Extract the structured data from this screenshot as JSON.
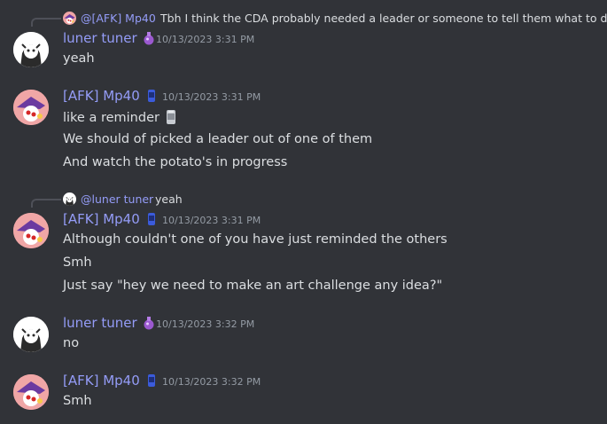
{
  "messages": [
    {
      "reply": {
        "author": "@[AFK] Mp40",
        "text": "Tbh I think the CDA probably needed a leader or someone to tell them what to do"
      },
      "author": "luner tuner",
      "timestamp": "10/13/2023 3:31 PM",
      "lines": [
        "yeah"
      ]
    },
    {
      "author": "[AFK] Mp40",
      "timestamp": "10/13/2023 3:31 PM",
      "lines": [
        "like a reminder",
        "We should of picked a leader out of one of them",
        "And watch the potato's in progress"
      ]
    },
    {
      "reply": {
        "author": "@luner tuner",
        "text": "yeah"
      },
      "author": "[AFK] Mp40",
      "timestamp": "10/13/2023 3:31 PM",
      "lines": [
        "Although couldn't one of you have just reminded the others",
        "Smh",
        "Just say \"hey we need to make an art challenge any idea?\""
      ]
    },
    {
      "author": "luner tuner",
      "timestamp": "10/13/2023 3:32 PM",
      "lines": [
        "no"
      ]
    },
    {
      "author": "[AFK] Mp40",
      "timestamp": "10/13/2023 3:32 PM",
      "lines": [
        "Smh"
      ]
    }
  ],
  "icons": {
    "luner_badge": "purple-potion-icon",
    "mp40_badge": "blue-can-icon",
    "reminder_emoji": "can-emoji-icon"
  },
  "colors": {
    "background": "#313338",
    "username": "#949cf7",
    "text": "#dbdee1",
    "timestamp": "#949ba4"
  }
}
